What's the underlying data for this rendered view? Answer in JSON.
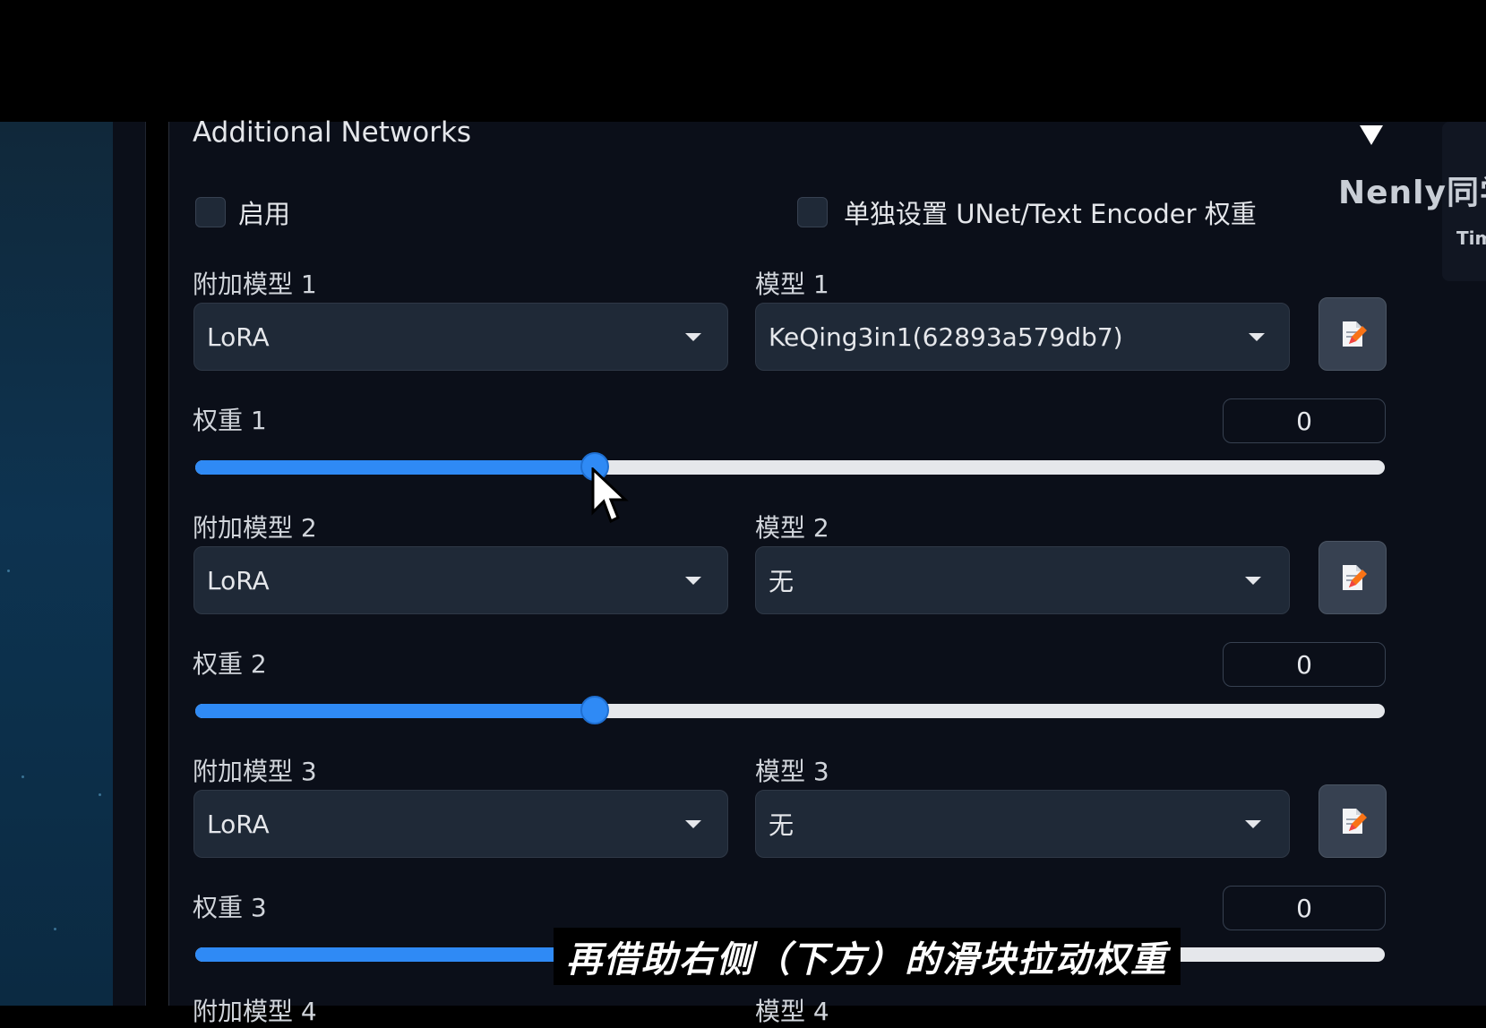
{
  "panel": {
    "title": "Additional Networks",
    "enable_label": "启用",
    "separate_weights_label": "单独设置 UNet/Text Encoder 权重"
  },
  "rows": [
    {
      "addon_label": "附加模型 1",
      "addon_value": "LoRA",
      "model_label": "模型 1",
      "model_value": "KeQing3in1(62893a579db7)",
      "weight_label": "权重 1",
      "weight_value": "0",
      "slider_fraction": 0.336
    },
    {
      "addon_label": "附加模型 2",
      "addon_value": "LoRA",
      "model_label": "模型 2",
      "model_value": "无",
      "weight_label": "权重 2",
      "weight_value": "0",
      "slider_fraction": 0.336
    },
    {
      "addon_label": "附加模型 3",
      "addon_value": "LoRA",
      "model_label": "模型 3",
      "model_value": "无",
      "weight_label": "权重 3",
      "weight_value": "0",
      "slider_fraction": 0.336
    }
  ],
  "partial_next": {
    "addon_label": "附加模型 4",
    "model_label": "模型 4"
  },
  "watermark": "Nenly同学",
  "right_sidebar_text": "Tim",
  "subtitle": "再借助右侧（下方）的滑块拉动权重",
  "colors": {
    "accent": "#2f8af5",
    "background": "#0b0f19",
    "input_bg": "#1f2937"
  },
  "icons": {
    "collapse": "triangle-down-icon",
    "edit": "edit-note-icon",
    "dropdown": "caret-down-icon"
  }
}
